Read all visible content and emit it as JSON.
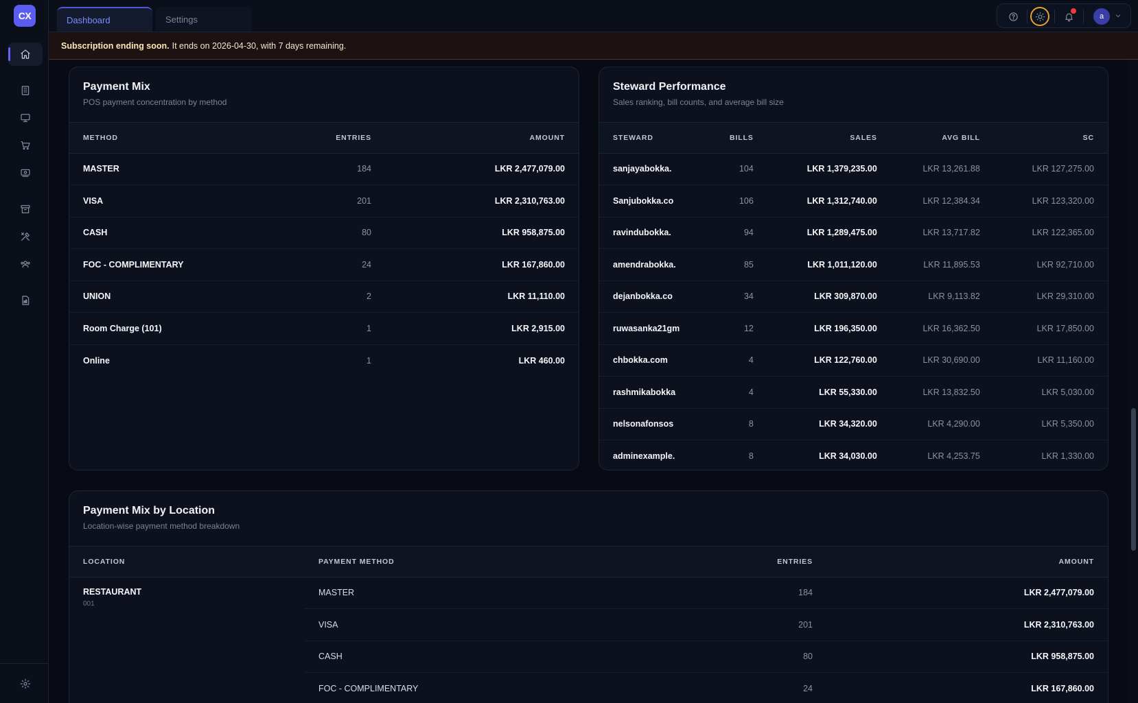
{
  "app": {
    "logo_text": "CX"
  },
  "tabs": [
    {
      "label": "Dashboard"
    },
    {
      "label": "Settings"
    }
  ],
  "header": {
    "avatar_initial": "a"
  },
  "banner": {
    "bold": "Subscription ending soon.",
    "text": "It ends on 2026-04-30, with 7 days remaining."
  },
  "payment_mix": {
    "title": "Payment Mix",
    "subtitle": "POS payment concentration by method",
    "columns": [
      "METHOD",
      "ENTRIES",
      "AMOUNT"
    ],
    "rows": [
      {
        "method": "MASTER",
        "entries": "184",
        "amount": "LKR 2,477,079.00"
      },
      {
        "method": "VISA",
        "entries": "201",
        "amount": "LKR 2,310,763.00"
      },
      {
        "method": "CASH",
        "entries": "80",
        "amount": "LKR 958,875.00"
      },
      {
        "method": "FOC - COMPLIMENTARY",
        "entries": "24",
        "amount": "LKR 167,860.00"
      },
      {
        "method": "UNION",
        "entries": "2",
        "amount": "LKR 11,110.00"
      },
      {
        "method": "Room Charge (101)",
        "entries": "1",
        "amount": "LKR 2,915.00"
      },
      {
        "method": "Online",
        "entries": "1",
        "amount": "LKR 460.00"
      }
    ]
  },
  "steward": {
    "title": "Steward Performance",
    "subtitle": "Sales ranking, bill counts, and average bill size",
    "columns": [
      "STEWARD",
      "BILLS",
      "SALES",
      "AVG BILL",
      "SC"
    ],
    "rows": [
      {
        "name": "sanjayabokka.",
        "bills": "104",
        "sales": "LKR 1,379,235.00",
        "avg": "LKR 13,261.88",
        "sc": "LKR 127,275.00"
      },
      {
        "name": "Sanjubokka.co",
        "bills": "106",
        "sales": "LKR 1,312,740.00",
        "avg": "LKR 12,384.34",
        "sc": "LKR 123,320.00"
      },
      {
        "name": "ravindubokka.",
        "bills": "94",
        "sales": "LKR 1,289,475.00",
        "avg": "LKR 13,717.82",
        "sc": "LKR 122,365.00"
      },
      {
        "name": "amendrabokka.",
        "bills": "85",
        "sales": "LKR 1,011,120.00",
        "avg": "LKR 11,895.53",
        "sc": "LKR 92,710.00"
      },
      {
        "name": "dejanbokka.co",
        "bills": "34",
        "sales": "LKR 309,870.00",
        "avg": "LKR 9,113.82",
        "sc": "LKR 29,310.00"
      },
      {
        "name": "ruwasanka21gm",
        "bills": "12",
        "sales": "LKR 196,350.00",
        "avg": "LKR 16,362.50",
        "sc": "LKR 17,850.00"
      },
      {
        "name": "chbokka.com",
        "bills": "4",
        "sales": "LKR 122,760.00",
        "avg": "LKR 30,690.00",
        "sc": "LKR 11,160.00"
      },
      {
        "name": "rashmikabokka",
        "bills": "4",
        "sales": "LKR 55,330.00",
        "avg": "LKR 13,832.50",
        "sc": "LKR 5,030.00"
      },
      {
        "name": "nelsonafonsos",
        "bills": "8",
        "sales": "LKR 34,320.00",
        "avg": "LKR 4,290.00",
        "sc": "LKR 5,350.00"
      },
      {
        "name": "adminexample.",
        "bills": "8",
        "sales": "LKR 34,030.00",
        "avg": "LKR 4,253.75",
        "sc": "LKR 1,330.00"
      }
    ]
  },
  "by_location": {
    "title": "Payment Mix by Location",
    "subtitle": "Location-wise payment method breakdown",
    "columns": [
      "LOCATION",
      "PAYMENT METHOD",
      "ENTRIES",
      "AMOUNT"
    ],
    "location": {
      "name": "RESTAURANT",
      "code": "001"
    },
    "rows": [
      {
        "method": "MASTER",
        "entries": "184",
        "amount": "LKR 2,477,079.00"
      },
      {
        "method": "VISA",
        "entries": "201",
        "amount": "LKR 2,310,763.00"
      },
      {
        "method": "CASH",
        "entries": "80",
        "amount": "LKR 958,875.00"
      },
      {
        "method": "FOC - COMPLIMENTARY",
        "entries": "24",
        "amount": "LKR 167,860.00"
      }
    ]
  },
  "icons": {
    "sidebar": [
      "home-icon",
      "building-icon",
      "monitor-icon",
      "cart-icon",
      "cash-icon",
      "archive-icon",
      "tools-icon",
      "users-icon",
      "report-icon",
      "settings-icon"
    ],
    "toolbar": [
      "help-icon",
      "theme-sun-icon",
      "bell-icon",
      "chevron-down-icon"
    ]
  },
  "colors": {
    "accent": "#6366f1",
    "banner_bg": "#1d1212",
    "notif": "#ef3b3b",
    "theme_ring": "#e5a22a"
  }
}
